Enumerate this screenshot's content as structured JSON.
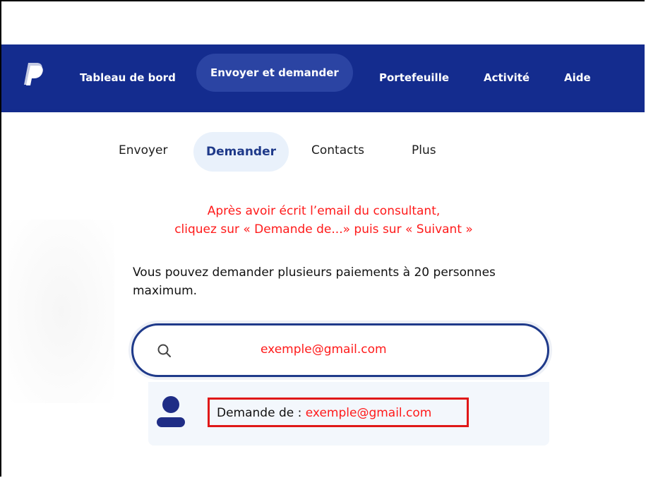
{
  "nav": {
    "items": [
      {
        "label": "Tableau de bord"
      },
      {
        "label": "Envoyer et demander"
      },
      {
        "label": "Portefeuille"
      },
      {
        "label": "Activité"
      },
      {
        "label": "Aide"
      }
    ],
    "active_index": 1,
    "logo_icon": "paypal-logo",
    "background": "#142c8e"
  },
  "subnav": {
    "items": [
      {
        "label": "Envoyer"
      },
      {
        "label": "Demander"
      },
      {
        "label": "Contacts"
      },
      {
        "label": "Plus"
      }
    ],
    "active_index": 1
  },
  "instruction": {
    "line1": "Après avoir écrit l’email du consultant,",
    "line2": "cliquez sur « Demande de...» puis sur « Suivant »",
    "color": "#ff1a1a"
  },
  "main": {
    "description": "Vous pouvez demander plusieurs paiements à 20 personnes maximum.",
    "search": {
      "value": "exemple@gmail.com",
      "icon": "search-icon"
    },
    "suggestion": {
      "prefix": "Demande de : ",
      "email": "exemple@gmail.com",
      "icon": "person-icon"
    }
  }
}
